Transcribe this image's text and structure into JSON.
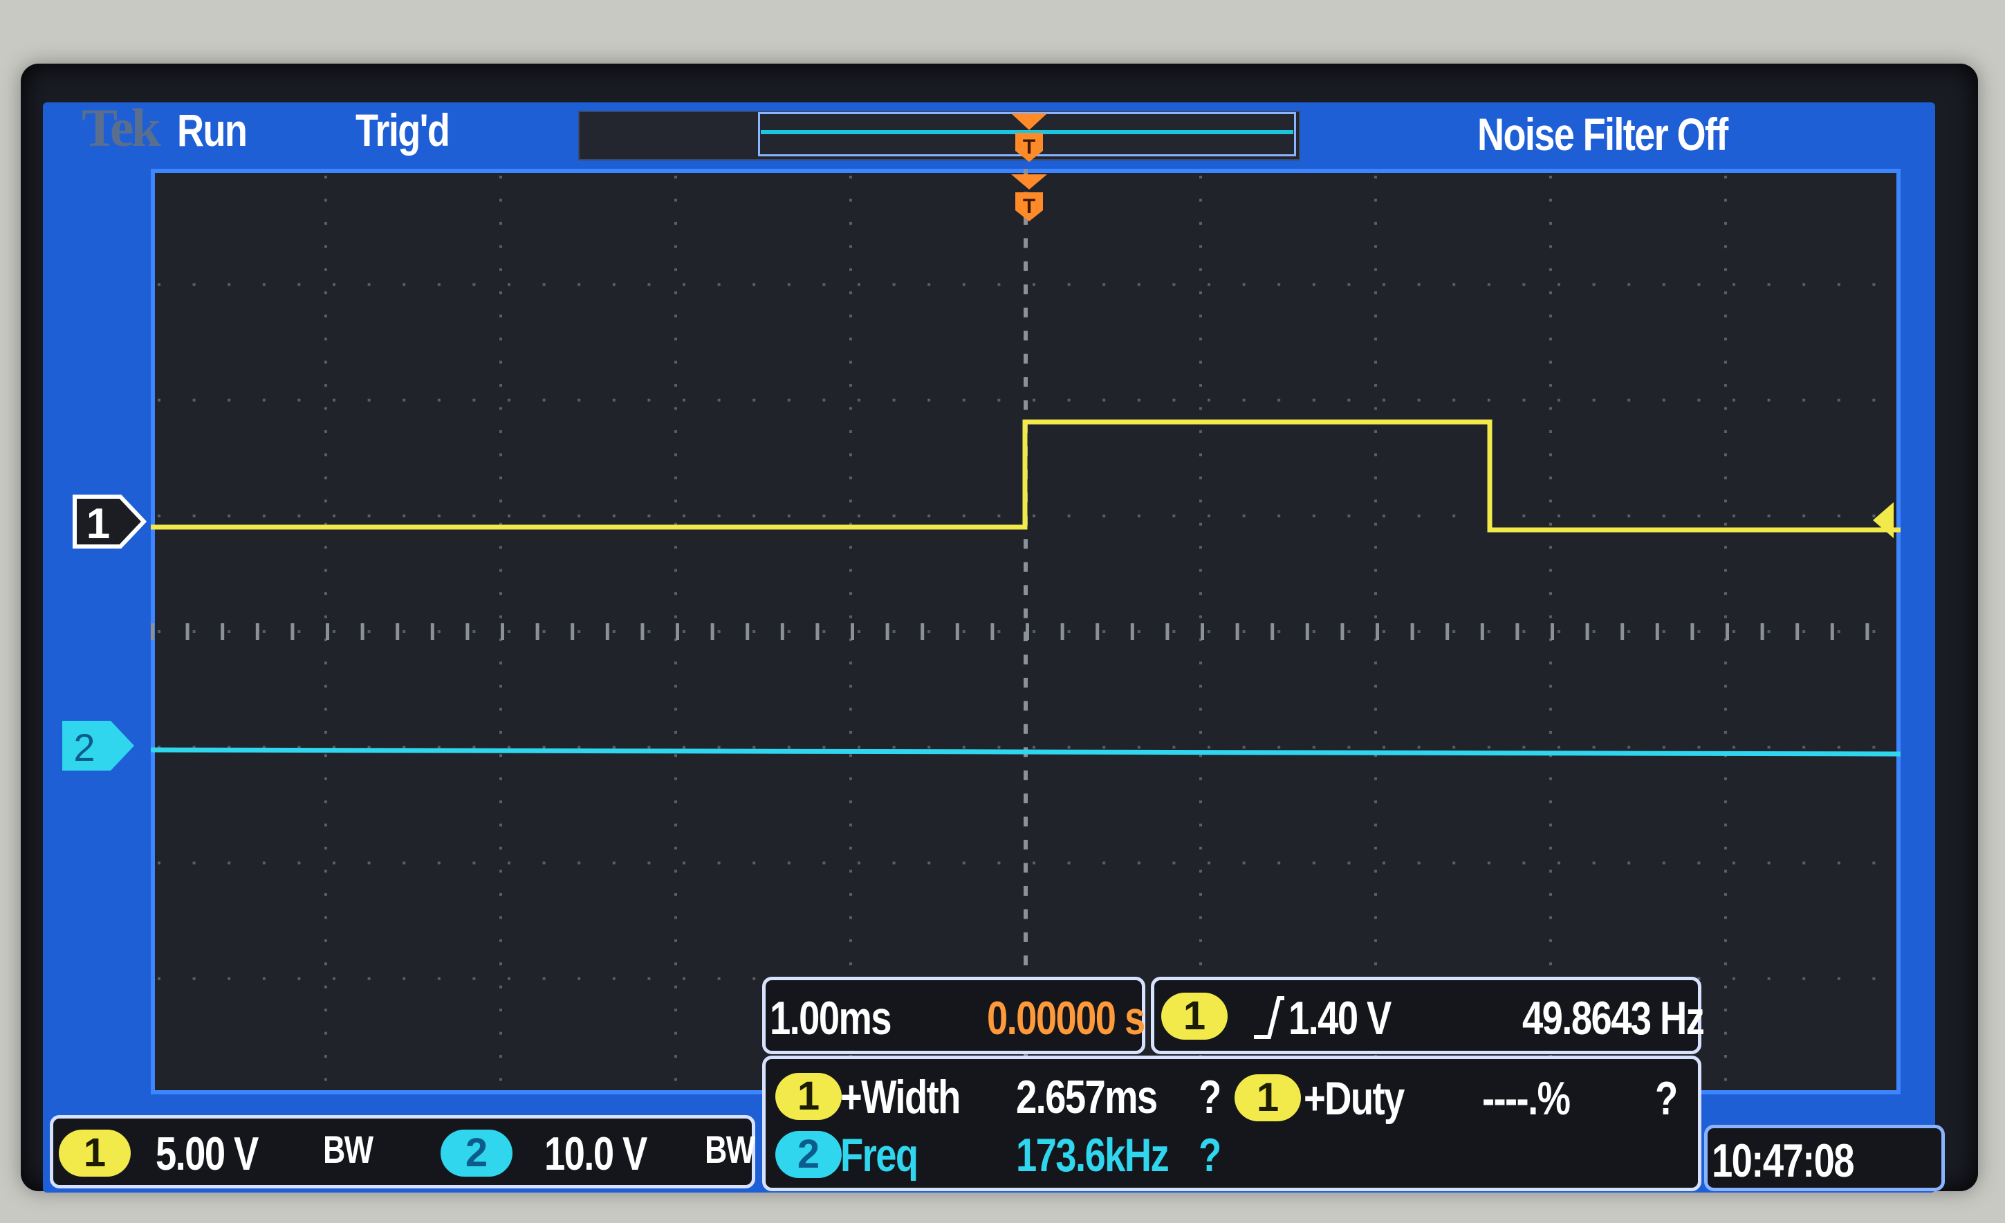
{
  "header": {
    "brand": "Tek",
    "run_state": "Run",
    "trigger_state": "Trig'd",
    "noise_filter": "Noise Filter Off"
  },
  "channels": [
    {
      "number": "1",
      "scale": "5.00 V",
      "bw": "BW",
      "color": "#f2ea4a"
    },
    {
      "number": "2",
      "scale": "10.0 V",
      "bw": "BW",
      "color": "#2fd6ee"
    }
  ],
  "horizontal": {
    "timebase": "1.00ms",
    "position": "0.00000 s"
  },
  "trigger": {
    "source": "1",
    "slope_icon": "rising-edge-icon",
    "level": "1.40 V",
    "frequency": "49.8643 Hz"
  },
  "measurements": [
    {
      "source": "1",
      "label": "+Width",
      "value": "2.657ms",
      "flag": "?"
    },
    {
      "source": "1",
      "label": "+Duty",
      "value": "----.%",
      "flag": "?"
    },
    {
      "source": "2",
      "label": "Freq",
      "value": "173.6kHz",
      "flag": "?"
    }
  ],
  "clock": "10:47:08",
  "colors": {
    "screen": "#1f5fd6",
    "graticule": "#202329",
    "ch1": "#f2ea4a",
    "ch2": "#2fd6ee",
    "trigger": "#ff8a2a"
  }
}
